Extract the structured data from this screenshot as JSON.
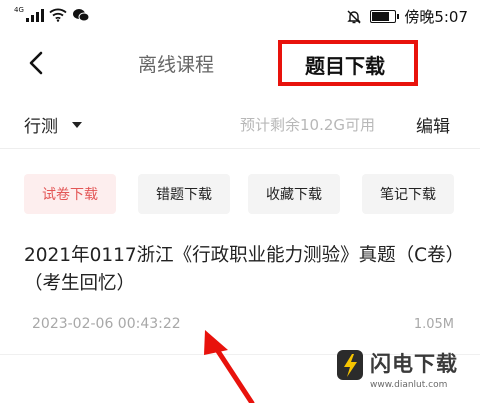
{
  "status_bar": {
    "signal_label": "4G",
    "time": "傍晚5:07",
    "battery_level": 0.8
  },
  "header": {
    "back_icon": "chevron-left-icon",
    "tab_offline": "离线课程",
    "tab_download": "题目下载"
  },
  "toolbar": {
    "subject": "行测",
    "storage": "预计剩余10.2G可用",
    "edit": "编辑"
  },
  "chips": [
    {
      "label": "试卷下载",
      "active": true
    },
    {
      "label": "错题下载",
      "active": false
    },
    {
      "label": "收藏下载",
      "active": false
    },
    {
      "label": "笔记下载",
      "active": false
    }
  ],
  "items": [
    {
      "title": "2021年0117浙江《行政职业能力测验》真题（C卷）（考生回忆）",
      "date": "2023-02-06 00:43:22",
      "size": "1.05M"
    }
  ],
  "watermark": {
    "name": "闪电下载",
    "url": "www.dianlut.com"
  },
  "colors": {
    "accent_red": "#e8120c",
    "chip_active_bg": "#fdeeee",
    "chip_active_text": "#e35656",
    "muted_text": "#a8a8a8"
  }
}
